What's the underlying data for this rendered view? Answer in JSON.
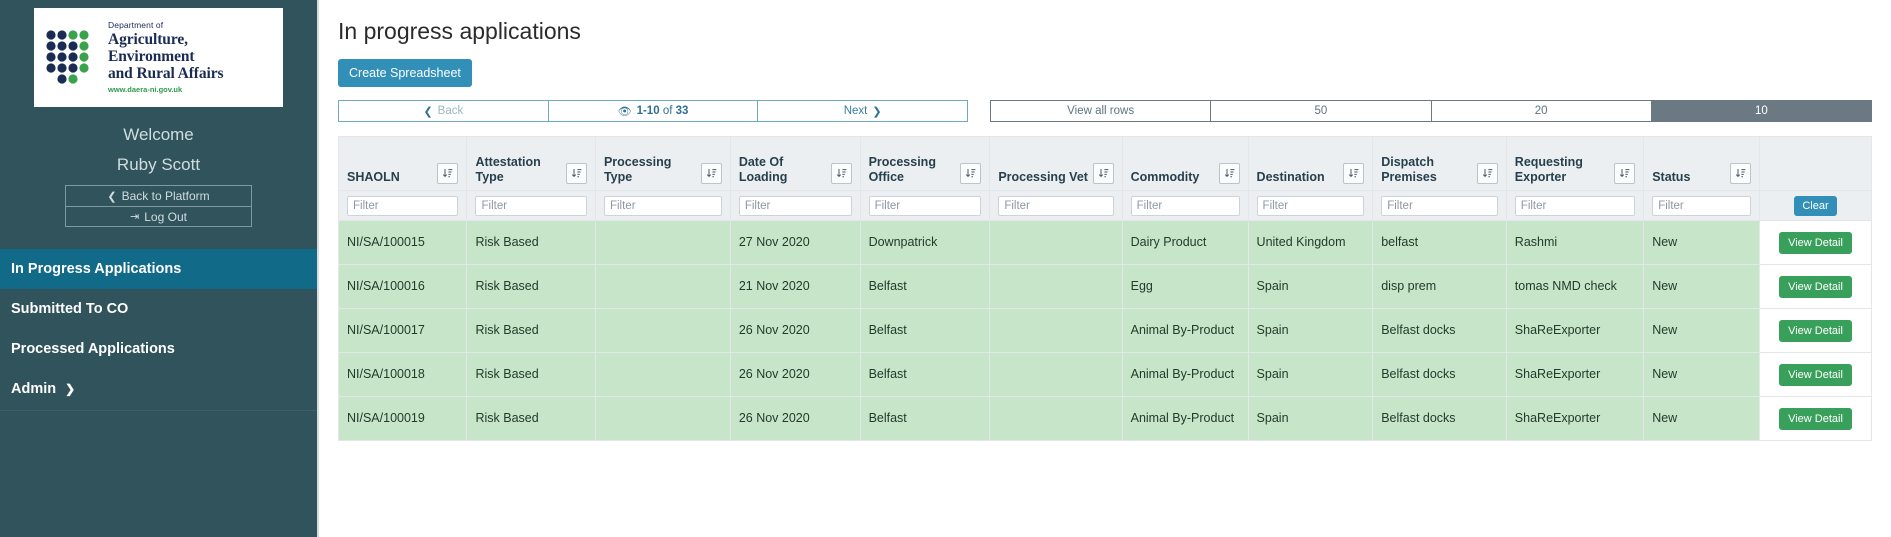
{
  "sidebar": {
    "logo": {
      "department_line": "Department of",
      "name_line1": "Agriculture, Environment",
      "name_line2": "and Rural Affairs",
      "url": "www.daera-ni.gov.uk"
    },
    "welcome_label": "Welcome",
    "user_name": "Ruby Scott",
    "back_to_platform": "Back to Platform",
    "log_out": "Log Out",
    "nav_items": [
      {
        "label": "In Progress Applications",
        "active": true,
        "has_chevron": false
      },
      {
        "label": "Submitted To CO",
        "active": false,
        "has_chevron": false
      },
      {
        "label": "Processed Applications",
        "active": false,
        "has_chevron": false
      },
      {
        "label": "Admin",
        "active": false,
        "has_chevron": true
      }
    ]
  },
  "main": {
    "page_title": "In progress applications",
    "create_spreadsheet_label": "Create Spreadsheet",
    "pagination": {
      "back_label": "Back",
      "range_start_end": "1-10",
      "of_word": "of",
      "total": "33",
      "next_label": "Next",
      "view_all_rows_label": "View all rows",
      "page_sizes": [
        "50",
        "20",
        "10"
      ],
      "selected_page_size": "10"
    },
    "table": {
      "columns": [
        "SHAOLN",
        "Attestation Type",
        "Processing Type",
        "Date Of Loading",
        "Processing Office",
        "Processing Vet",
        "Commodity",
        "Destination",
        "Dispatch Premises",
        "Requesting Exporter",
        "Status"
      ],
      "filter_placeholder": "Filter",
      "clear_label": "Clear",
      "row_action_label": "View Detail",
      "rows": [
        {
          "shaoln": "NI/SA/100015",
          "attestation_type": "Risk Based",
          "processing_type": "",
          "date_of_loading": "27 Nov 2020",
          "processing_office": "Downpatrick",
          "processing_vet": "",
          "commodity": "Dairy Product",
          "destination": "United Kingdom",
          "dispatch_premises": "belfast",
          "requesting_exporter": "Rashmi",
          "status": "New"
        },
        {
          "shaoln": "NI/SA/100016",
          "attestation_type": "Risk Based",
          "processing_type": "",
          "date_of_loading": "21 Nov 2020",
          "processing_office": "Belfast",
          "processing_vet": "",
          "commodity": "Egg",
          "destination": "Spain",
          "dispatch_premises": "disp prem",
          "requesting_exporter": "tomas NMD check",
          "status": "New"
        },
        {
          "shaoln": "NI/SA/100017",
          "attestation_type": "Risk Based",
          "processing_type": "",
          "date_of_loading": "26 Nov 2020",
          "processing_office": "Belfast",
          "processing_vet": "",
          "commodity": "Animal By-Product",
          "destination": "Spain",
          "dispatch_premises": "Belfast docks",
          "requesting_exporter": "ShaReExporter",
          "status": "New"
        },
        {
          "shaoln": "NI/SA/100018",
          "attestation_type": "Risk Based",
          "processing_type": "",
          "date_of_loading": "26 Nov 2020",
          "processing_office": "Belfast",
          "processing_vet": "",
          "commodity": "Animal By-Product",
          "destination": "Spain",
          "dispatch_premises": "Belfast docks",
          "requesting_exporter": "ShaReExporter",
          "status": "New"
        },
        {
          "shaoln": "NI/SA/100019",
          "attestation_type": "Risk Based",
          "processing_type": "",
          "date_of_loading": "26 Nov 2020",
          "processing_office": "Belfast",
          "processing_vet": "",
          "commodity": "Animal By-Product",
          "destination": "Spain",
          "dispatch_premises": "Belfast docks",
          "requesting_exporter": "ShaReExporter",
          "status": "New"
        }
      ]
    }
  },
  "colors": {
    "sidebar_bg": "#31535c",
    "nav_active": "#126a89",
    "primary_button": "#3290b8",
    "row_green": "#c7e6c9",
    "view_button": "#38a05a",
    "header_grey": "#eceff1",
    "pager_selected": "#6b7a82"
  }
}
